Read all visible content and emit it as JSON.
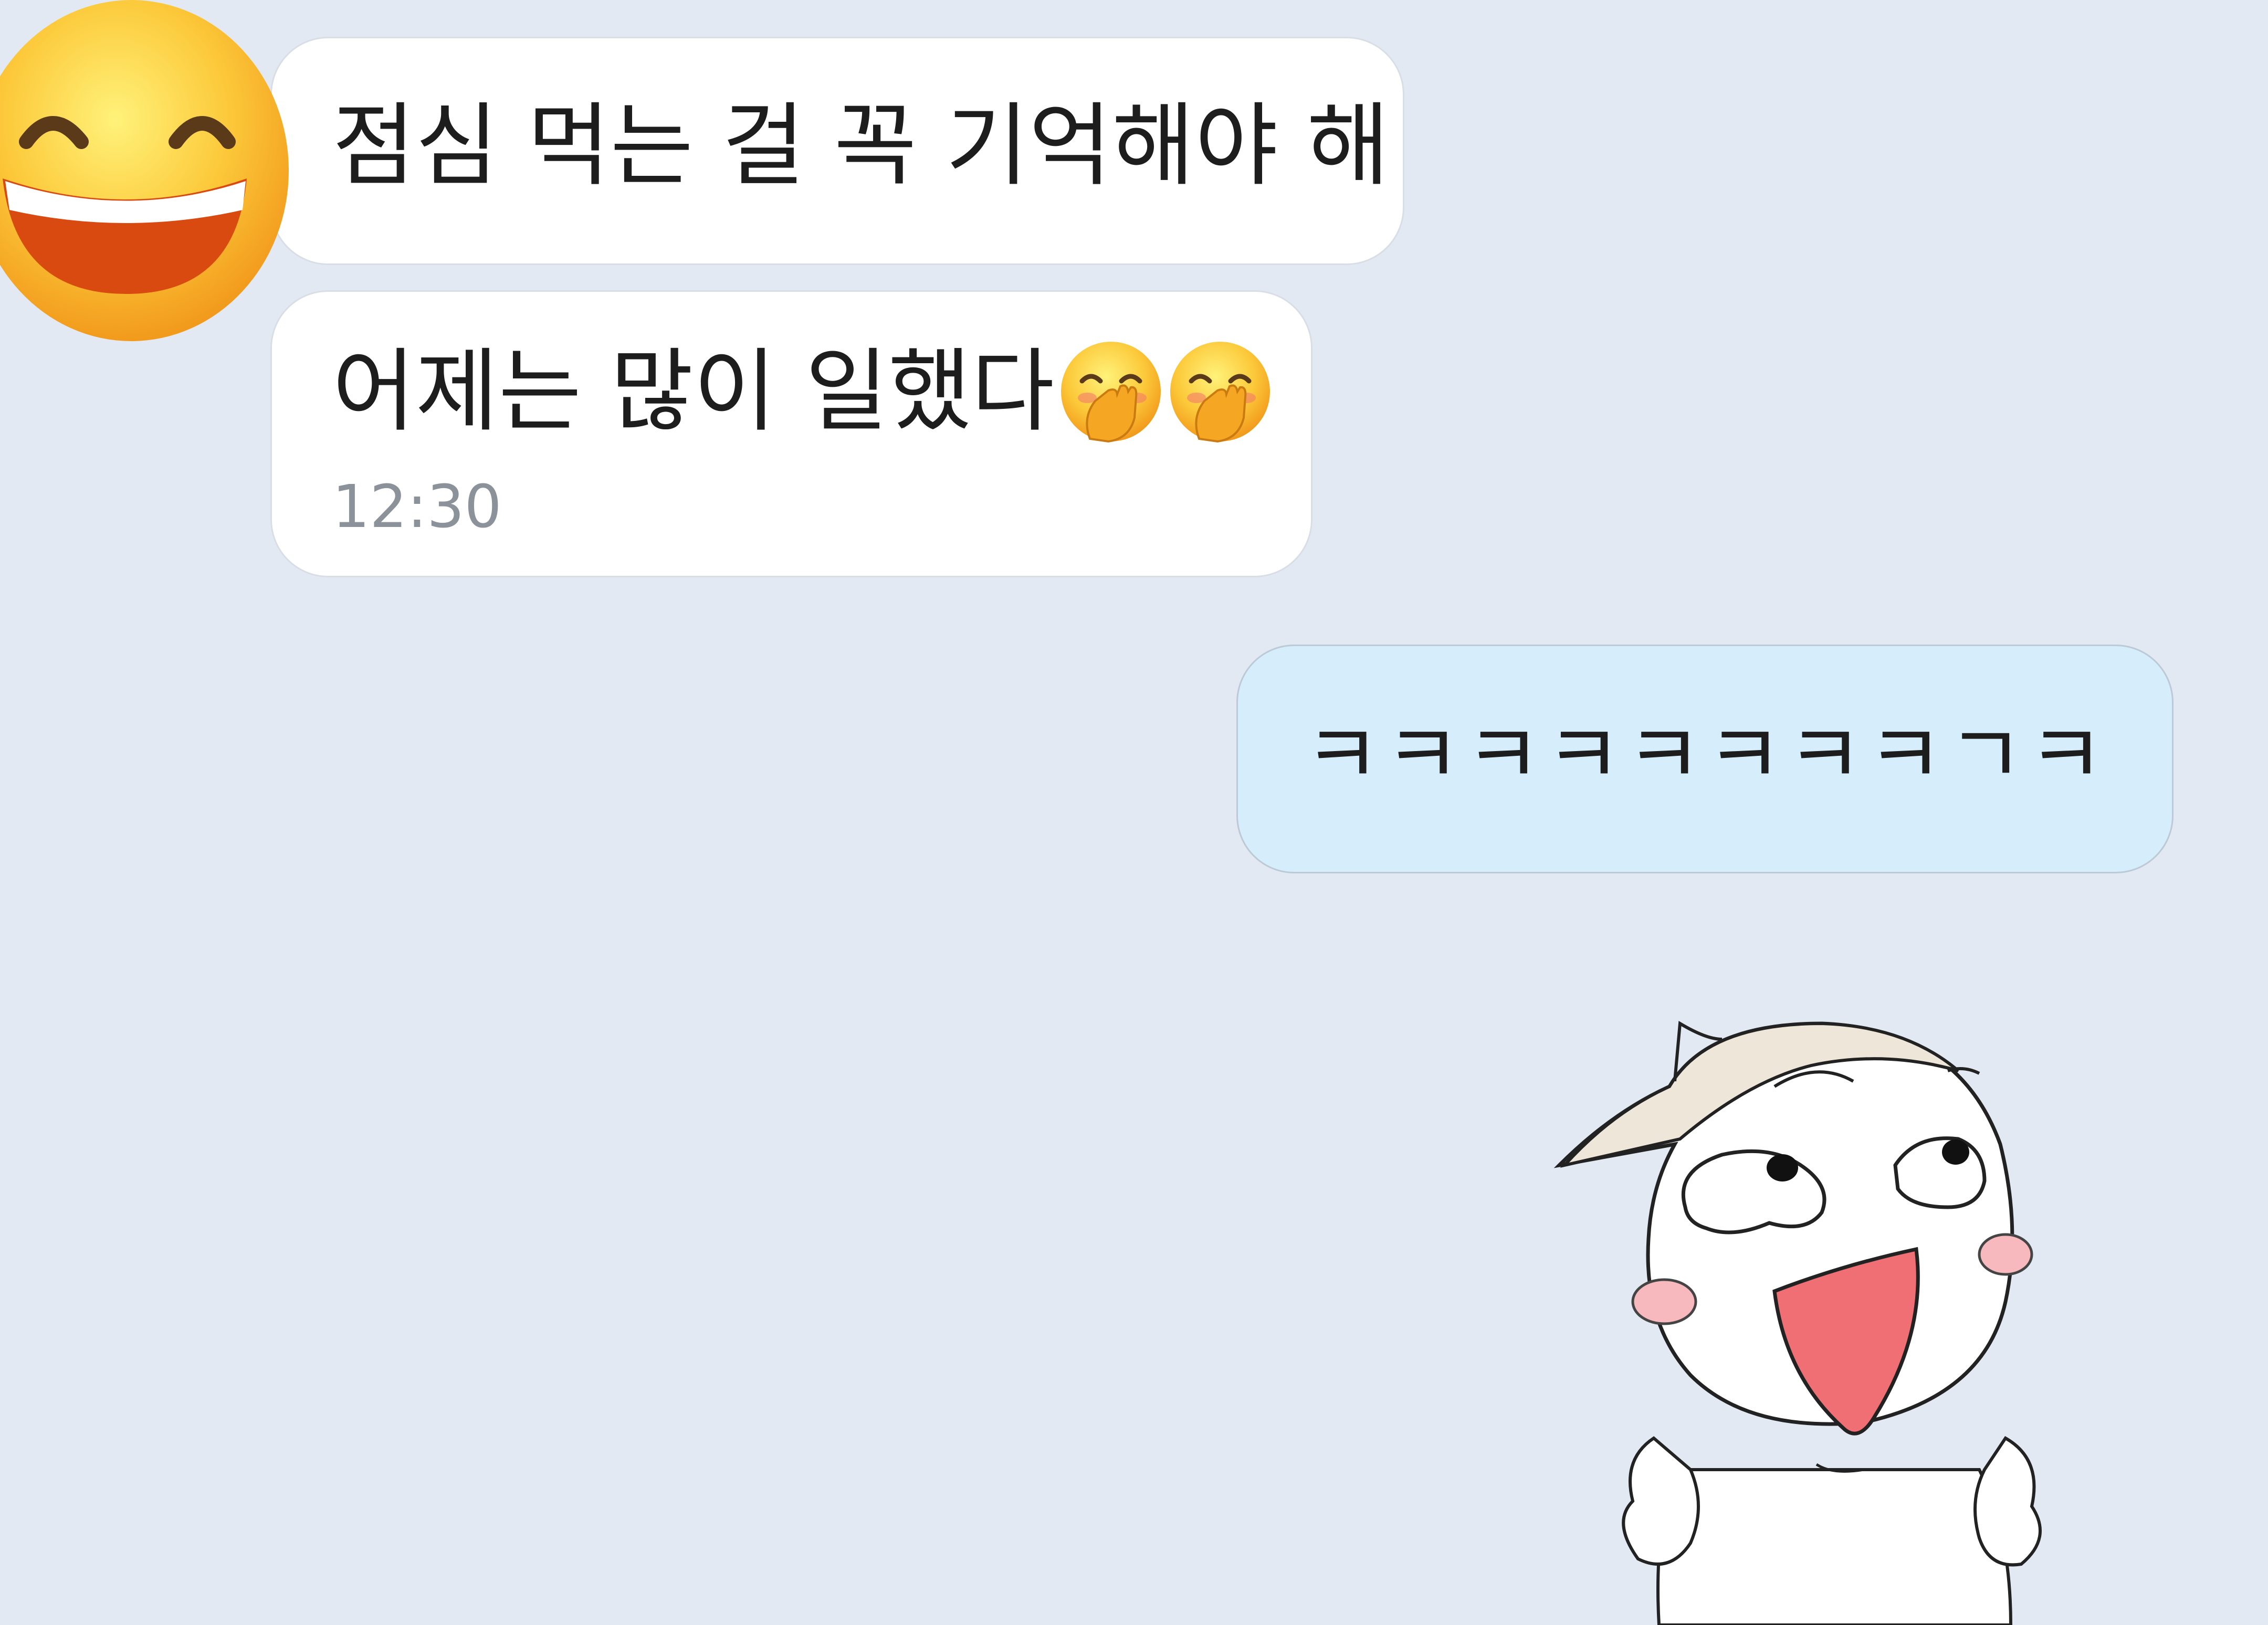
{
  "conversation": {
    "avatar_icon": "grinning-face-with-smiling-eyes-icon",
    "messages": [
      {
        "direction": "incoming",
        "text": "점심 먹는 걸 꼭 기억해야 해"
      },
      {
        "direction": "incoming",
        "text": "어제는 많이 일했다",
        "emojis": [
          "face-with-hand-over-mouth-icon",
          "face-with-hand-over-mouth-icon"
        ],
        "time": "12:30"
      },
      {
        "direction": "outgoing",
        "text": "ㅋㅋㅋㅋㅋㅋㅋㅋㄱㅋ"
      }
    ],
    "sticker": {
      "icon": "laughing-cat-sticker"
    }
  },
  "colors": {
    "background": "#e3e9f3",
    "incoming_bubble": "#ffffff",
    "outgoing_bubble": "#d6edfc",
    "timestamp": "#8c9299"
  }
}
